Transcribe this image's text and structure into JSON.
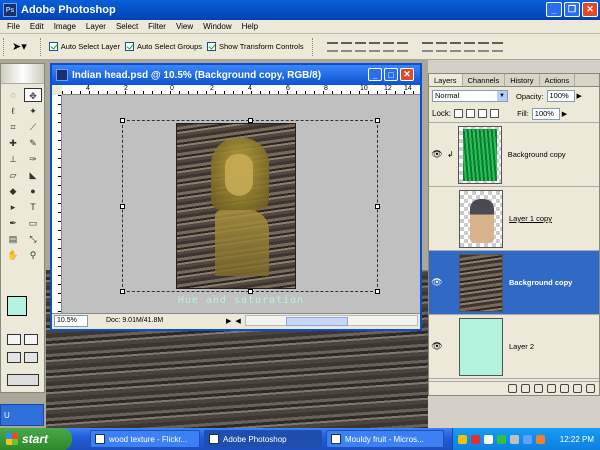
{
  "app": {
    "title": "Adobe Photoshop",
    "logo": "Ps"
  },
  "menu": [
    "File",
    "Edit",
    "Image",
    "Layer",
    "Select",
    "Filter",
    "View",
    "Window",
    "Help"
  ],
  "options_bar": {
    "move_tool_icon": "move-arrow-icon",
    "auto_select_layer": "Auto Select Layer",
    "auto_select_groups": "Auto Select Groups",
    "show_transform_controls": "Show Transform Controls"
  },
  "document": {
    "title": "Indian head.psd @ 10.5% (Background copy, RGB/8)",
    "overlay_text": "Hue and saturation",
    "zoom": "10.5%",
    "doc_info": "Doc: 9.01M/41.8M",
    "ruler_numbers": [
      "4",
      "2",
      "0",
      "2",
      "4",
      "6",
      "8",
      "10",
      "12",
      "14"
    ]
  },
  "layers_panel": {
    "tabs": [
      "Layers",
      "Channels",
      "History",
      "Actions"
    ],
    "blend_mode": "Normal",
    "opacity_label": "Opacity:",
    "opacity_value": "100%",
    "lock_label": "Lock:",
    "fill_label": "Fill:",
    "fill_value": "100%",
    "layers": [
      {
        "name": "Background copy",
        "thumb": "green-texture",
        "visible": true,
        "selected": false
      },
      {
        "name": "Layer 1 copy",
        "thumb": "indian-head",
        "visible": false,
        "selected": false
      },
      {
        "name": "Background copy",
        "thumb": "wood",
        "visible": true,
        "selected": true
      },
      {
        "name": "Layer 2",
        "thumb": "mint",
        "visible": true,
        "selected": false
      }
    ]
  },
  "tools": {
    "foreground_color": "#b3f2dc",
    "background_color": "#ffffff"
  },
  "side_tab": "U",
  "taskbar": {
    "start": "start",
    "tasks": [
      {
        "label": "wood texture - Flickr...",
        "active": false
      },
      {
        "label": "Adobe Photoshop",
        "active": true
      },
      {
        "label": "Mouldy fruit - Micros...",
        "active": false
      }
    ],
    "clock": "12:22 PM"
  },
  "colors": {
    "xp_blue": "#0b53d4",
    "selected_layer": "#316ac5",
    "mint": "#b3f2dc"
  }
}
